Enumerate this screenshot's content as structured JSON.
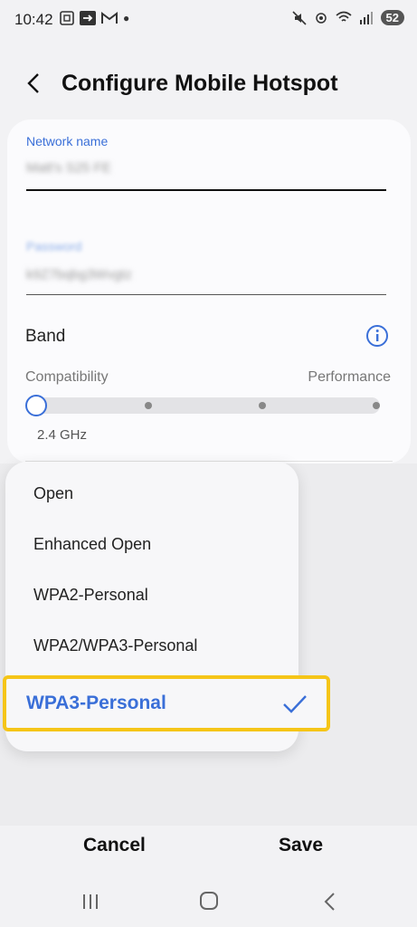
{
  "status_bar": {
    "time": "10:42",
    "battery": "52",
    "left_icons": [
      "screenshot-icon",
      "cast-icon",
      "gmail-icon",
      "dot-icon"
    ],
    "right_icons": [
      "mute-icon",
      "hotspot-icon",
      "wifi-icon",
      "signal-icon"
    ]
  },
  "header": {
    "title": "Configure Mobile Hotspot"
  },
  "form": {
    "network_name_label": "Network name",
    "network_name_value": "Matt's S25 FE",
    "password_label": "Password",
    "password_value": "k9Z7bqbg3Wvgtz",
    "band_label": "Band",
    "compatibility_label": "Compatibility",
    "performance_label": "Performance",
    "band_value": "2.4 GHz",
    "band_level": 0
  },
  "security_dropdown": {
    "options": [
      "Open",
      "Enhanced Open",
      "WPA2-Personal",
      "WPA2/WPA3-Personal"
    ],
    "selected": "WPA3-Personal"
  },
  "actions": {
    "cancel": "Cancel",
    "save": "Save"
  },
  "colors": {
    "accent": "#3a6fd8",
    "highlight": "#f5c518"
  }
}
